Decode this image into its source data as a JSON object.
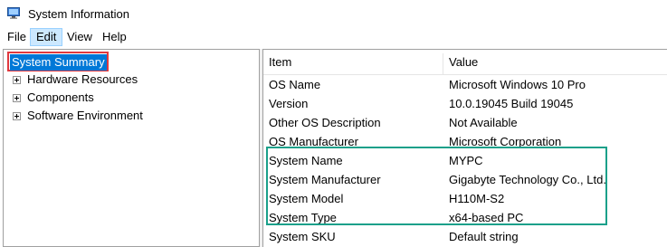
{
  "window": {
    "title": "System Information",
    "icon": "system-information-app-icon"
  },
  "menu": [
    "File",
    "Edit",
    "View",
    "Help"
  ],
  "tree": {
    "selected": "System Summary",
    "items": [
      "Hardware Resources",
      "Components",
      "Software Environment"
    ]
  },
  "table": {
    "headers": {
      "item": "Item",
      "value": "Value"
    },
    "rows": [
      {
        "item": "OS Name",
        "value": "Microsoft Windows 10 Pro"
      },
      {
        "item": "Version",
        "value": "10.0.19045 Build 19045"
      },
      {
        "item": "Other OS Description",
        "value": "Not Available"
      },
      {
        "item": "OS Manufacturer",
        "value": "Microsoft Corporation"
      },
      {
        "item": "System Name",
        "value": "MYPC"
      },
      {
        "item": "System Manufacturer",
        "value": "Gigabyte Technology Co., Ltd."
      },
      {
        "item": "System Model",
        "value": "H110M-S2"
      },
      {
        "item": "System Type",
        "value": "x64-based PC"
      },
      {
        "item": "System SKU",
        "value": "Default string"
      }
    ]
  },
  "colors": {
    "selection": "#0078d7",
    "highlight_red": "#e0393e",
    "highlight_green": "#1aa08a",
    "menu_hover": "#cce8ff"
  }
}
